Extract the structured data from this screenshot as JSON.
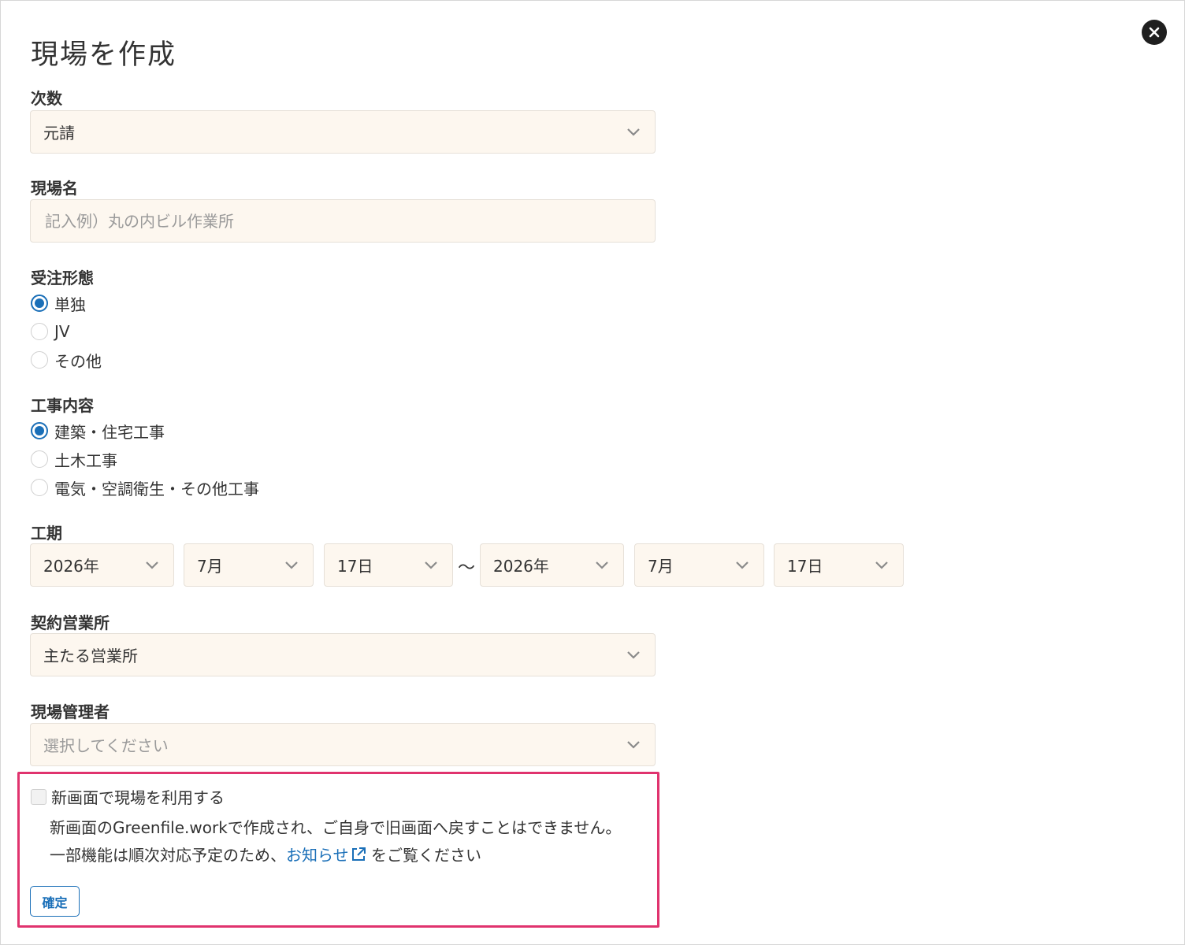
{
  "dialog": {
    "title": "現場を作成"
  },
  "order_level": {
    "label": "次数",
    "value": "元請"
  },
  "site_name": {
    "label": "現場名",
    "placeholder": "記入例）丸の内ビル作業所"
  },
  "order_type": {
    "label": "受注形態",
    "options": [
      {
        "label": "単独",
        "selected": true
      },
      {
        "label": "JV",
        "selected": false
      },
      {
        "label": "その他",
        "selected": false
      }
    ]
  },
  "work_content": {
    "label": "工事内容",
    "options": [
      {
        "label": "建築・住宅工事",
        "selected": true
      },
      {
        "label": "土木工事",
        "selected": false
      },
      {
        "label": "電気・空調衛生・その他工事",
        "selected": false
      }
    ]
  },
  "period": {
    "label": "工期",
    "start": {
      "year": "2026年",
      "month": "7月",
      "day": "17日"
    },
    "separator": "〜",
    "end": {
      "year": "2026年",
      "month": "7月",
      "day": "17日"
    }
  },
  "office": {
    "label": "契約営業所",
    "value": "主たる営業所"
  },
  "manager": {
    "label": "現場管理者",
    "placeholder": "選択してください"
  },
  "new_screen": {
    "checkbox_label": "新画面で現場を利用する",
    "checked": false,
    "desc_line1": "新画面のGreenfile.workで作成され、ご自身で旧画面へ戻すことはできません。",
    "desc_line2_before": "一部機能は順次対応予定のため、",
    "desc_link": "お知らせ",
    "desc_line2_after": " をご覧ください"
  },
  "actions": {
    "confirm_label": "確定"
  },
  "colors": {
    "accent": "#1a6fb8",
    "field_bg": "#fdf7ef",
    "highlight": "#e0336e"
  }
}
